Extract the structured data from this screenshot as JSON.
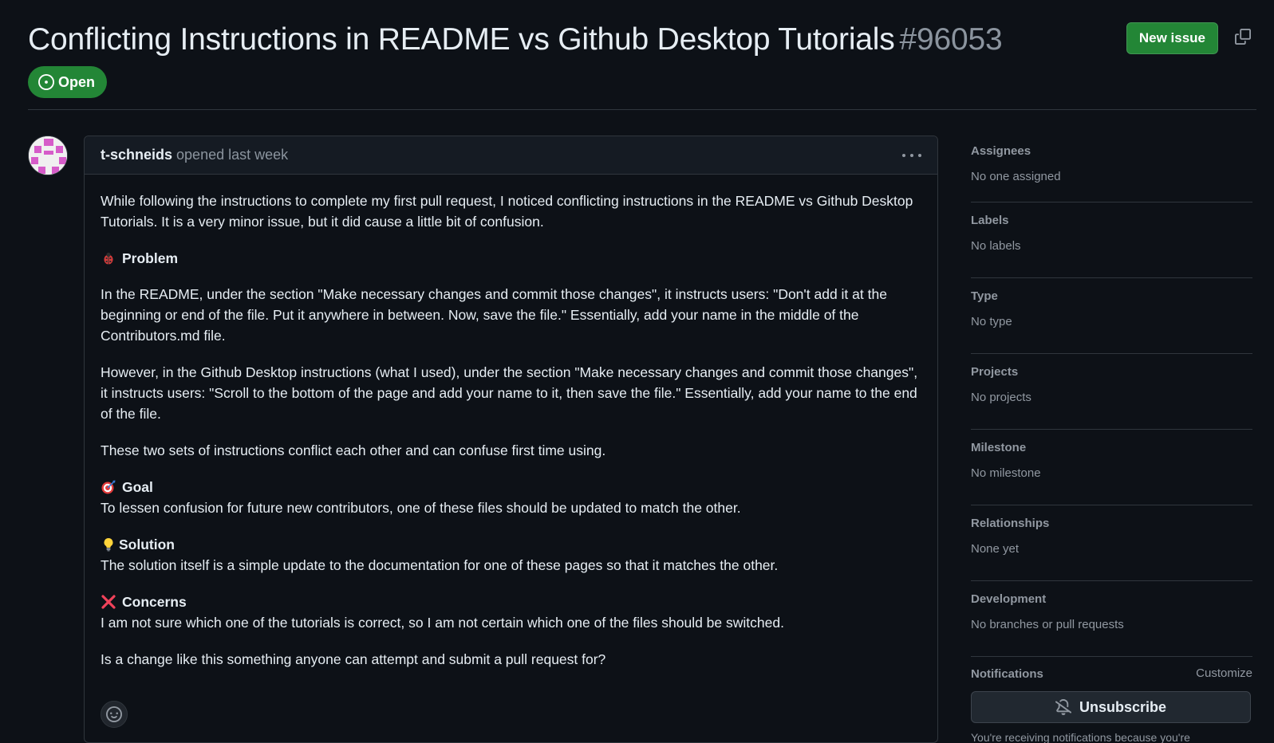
{
  "issue": {
    "title": "Conflicting Instructions in README vs Github Desktop Tutorials",
    "number": "#96053",
    "state": "Open",
    "new_issue_label": "New issue"
  },
  "comment": {
    "author": "t-schneids",
    "timestamp": "opened last week",
    "body": {
      "intro": "While following the instructions to complete my first pull request, I noticed conflicting instructions in the README vs Github Desktop Tutorials. It is a very minor issue, but it did cause a little bit of confusion.",
      "problem_heading": "Problem",
      "problem_p1": "In the README, under the section \"Make necessary changes and commit those changes\", it instructs users: \"Don't add it at the beginning or end of the file. Put it anywhere in between. Now, save the file.\" Essentially, add your name in the middle of the Contributors.md file.",
      "problem_p2": "However, in the Github Desktop instructions (what I used), under the section \"Make necessary changes and commit those changes\", it instructs users: \"Scroll to the bottom of the page and add your name to it, then save the file.\" Essentially, add your name to the end of the file.",
      "problem_p3": "These two sets of instructions conflict each other and can confuse first time using.",
      "goal_heading": "Goal",
      "goal_text": "To lessen confusion for future new contributors, one of these files should be updated to match the other.",
      "solution_heading": "Solution",
      "solution_text": "The solution itself is a simple update to the documentation for one of these pages so that it matches the other.",
      "concerns_heading": "Concerns",
      "concerns_text": "I am not sure which one of the tutorials is correct, so I am not certain which one of the files should be switched.",
      "closing": "Is a change like this something anyone can attempt and submit a pull request for?"
    }
  },
  "sidebar": {
    "assignees_label": "Assignees",
    "assignees_value": "No one assigned",
    "labels_label": "Labels",
    "labels_value": "No labels",
    "type_label": "Type",
    "type_value": "No type",
    "projects_label": "Projects",
    "projects_value": "No projects",
    "milestone_label": "Milestone",
    "milestone_value": "No milestone",
    "relationships_label": "Relationships",
    "relationships_value": "None yet",
    "development_label": "Development",
    "development_value": "No branches or pull requests",
    "notifications_label": "Notifications",
    "customize_label": "Customize",
    "unsubscribe_label": "Unsubscribe",
    "notifications_note": "You're receiving notifications because you're"
  },
  "icons": {
    "state": "issue-opened-icon",
    "copy": "copy-icon",
    "bug": "bug-emoji",
    "goal": "direct-hit-emoji",
    "solution": "light-bulb-emoji",
    "concerns": "cross-mark-emoji",
    "reaction": "smiley-icon",
    "unsubscribe": "bell-slash-icon"
  },
  "colors": {
    "background": "#0d1117",
    "open_green": "#238636",
    "border": "#30363d",
    "muted_text": "#9198a1"
  }
}
